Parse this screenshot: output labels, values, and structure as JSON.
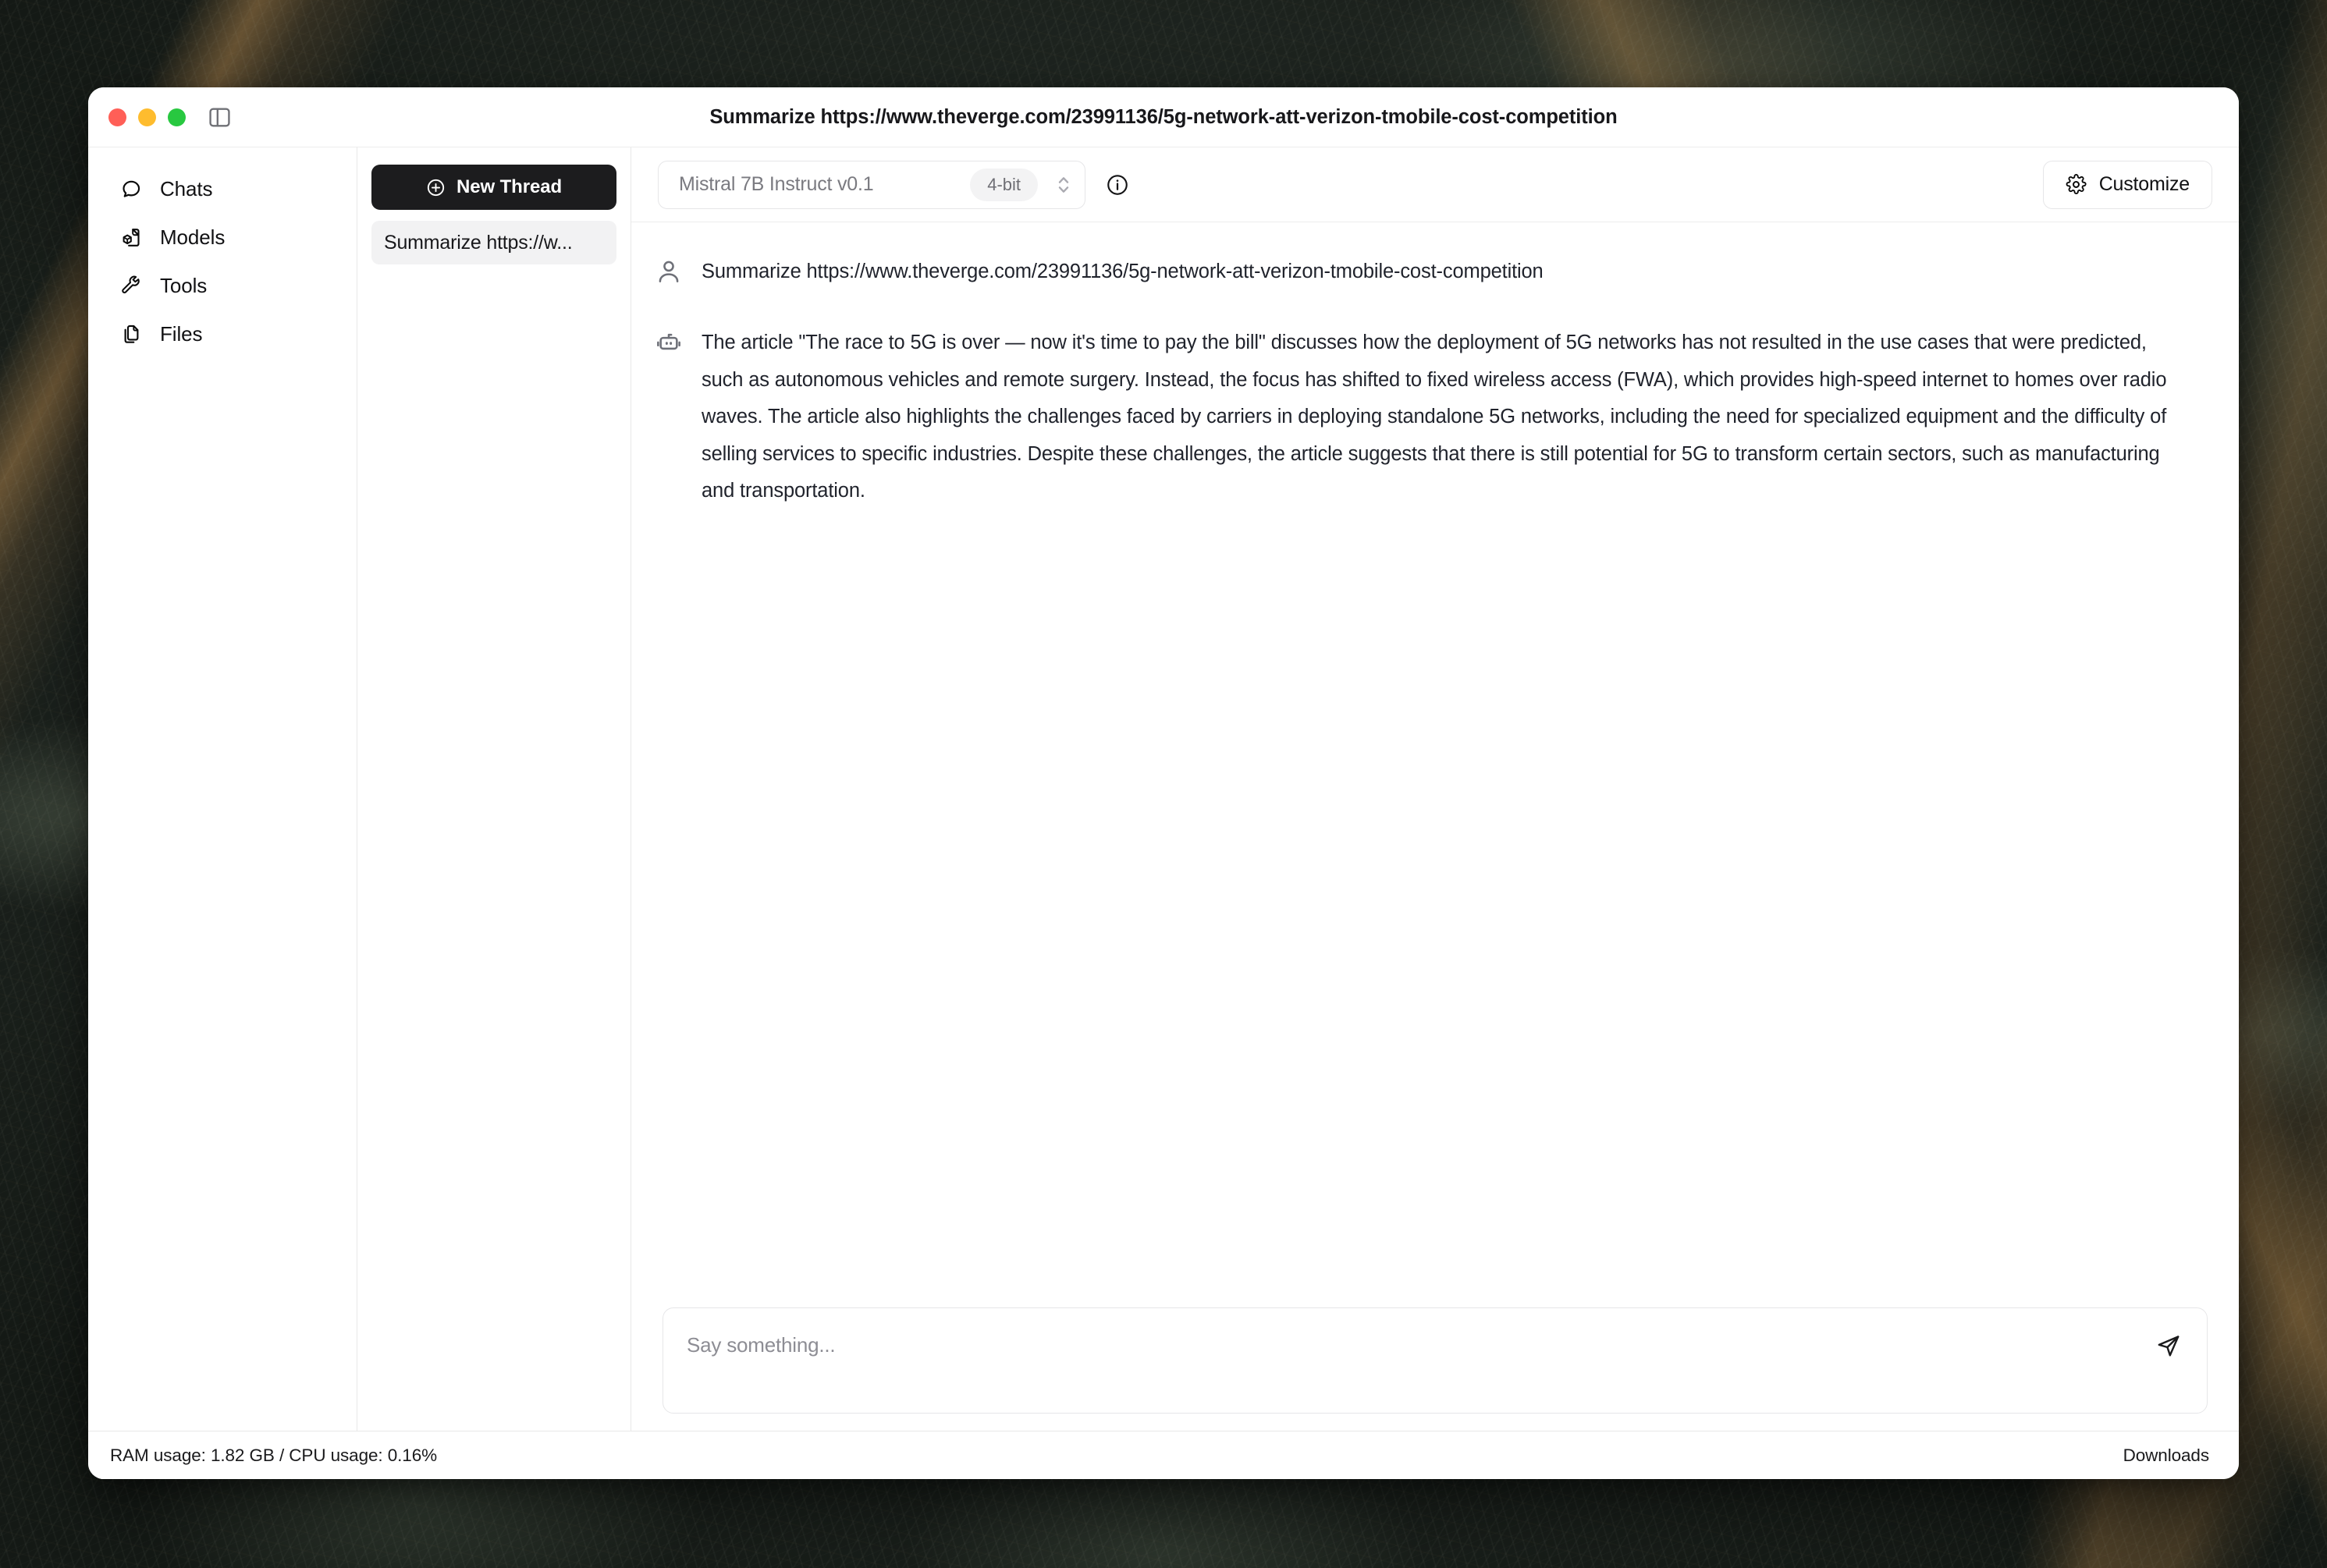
{
  "window": {
    "title": "Summarize https://www.theverge.com/23991136/5g-network-att-verizon-tmobile-cost-competition",
    "traffic_lights": {
      "close": "close-button",
      "minimize": "minimize-button",
      "zoom": "zoom-button"
    },
    "sidebar_toggle_icon": "sidebar-toggle-icon"
  },
  "sidebar": {
    "items": [
      {
        "label": "Chats",
        "icon": "chat-bubble-icon"
      },
      {
        "label": "Models",
        "icon": "model-file-icon"
      },
      {
        "label": "Tools",
        "icon": "wrench-icon"
      },
      {
        "label": "Files",
        "icon": "files-copy-icon"
      }
    ]
  },
  "threads": {
    "new_thread_label": "New Thread",
    "new_thread_icon": "plus-circle-icon",
    "items": [
      {
        "title": "Summarize https://w...",
        "selected": true
      }
    ]
  },
  "chat_header": {
    "model_name": "Mistral 7B Instruct v0.1",
    "quantization": "4-bit",
    "chevron_icon": "chevron-up-down-icon",
    "info_icon": "info-circle-icon",
    "customize_label": "Customize",
    "customize_icon": "gear-icon"
  },
  "messages": [
    {
      "role": "user",
      "avatar_icon": "person-icon",
      "text": "Summarize https://www.theverge.com/23991136/5g-network-att-verizon-tmobile-cost-competition"
    },
    {
      "role": "assistant",
      "avatar_icon": "robot-icon",
      "text": "The article \"The race to 5G is over — now it's time to pay the bill\" discusses how the deployment of 5G networks has not resulted in the use cases that were predicted, such as autonomous vehicles and remote surgery. Instead, the focus has shifted to fixed wireless access (FWA), which provides high-speed internet to homes over radio waves. The article also highlights the challenges faced by carriers in deploying standalone 5G networks, including the need for specialized equipment and the difficulty of selling services to specific industries. Despite these challenges, the article suggests that there is still potential for 5G to transform certain sectors, such as manufacturing and transportation."
    }
  ],
  "composer": {
    "placeholder": "Say something...",
    "value": "",
    "send_icon": "send-paper-plane-icon"
  },
  "statusbar": {
    "resource_usage": "RAM usage: 1.82 GB / CPU usage: 0.16%",
    "downloads_label": "Downloads"
  },
  "colors": {
    "accent_dark": "#1c1c1e",
    "selected_row": "#f2f2f3",
    "text_primary": "#18181b",
    "text_muted": "#7a7a80",
    "border": "#e6e6e8",
    "traffic_close": "#ff5f57",
    "traffic_minimize": "#febc2e",
    "traffic_zoom": "#28c840",
    "desktop": "#242b25"
  }
}
